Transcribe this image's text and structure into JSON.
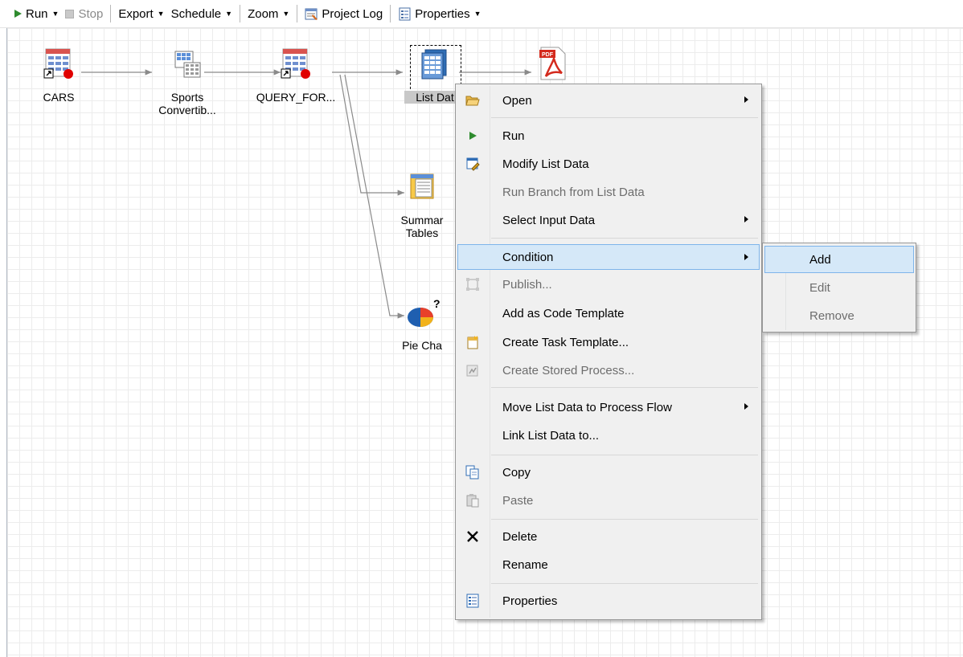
{
  "toolbar": {
    "run": "Run",
    "stop": "Stop",
    "export": "Export",
    "schedule": "Schedule",
    "zoom": "Zoom",
    "project_log": "Project Log",
    "properties": "Properties"
  },
  "flow": {
    "nodes": {
      "cars": "CARS",
      "sports_1": "Sports",
      "sports_2": "Convertib...",
      "query": "QUERY_FOR...",
      "list_data": "List Dat",
      "summary_1": "Summar",
      "summary_2": "Tables",
      "pie": "Pie Cha"
    },
    "pdf_badge": "PDF"
  },
  "context_menu": {
    "items": {
      "open": "Open",
      "run": "Run",
      "modify": "Modify List Data",
      "run_branch": "Run Branch from List Data",
      "select_input": "Select Input Data",
      "condition": "Condition",
      "publish": "Publish...",
      "add_code_template": "Add as Code Template",
      "create_task_template": "Create Task Template...",
      "create_stored_process": "Create Stored Process...",
      "move": "Move List Data to Process Flow",
      "link": "Link List Data to...",
      "copy": "Copy",
      "paste": "Paste",
      "delete": "Delete",
      "rename": "Rename",
      "properties": "Properties"
    }
  },
  "submenu": {
    "add": "Add",
    "edit": "Edit",
    "remove": "Remove"
  },
  "colors": {
    "highlight": "#d5e8f8",
    "highlight_border": "#7eb4ea",
    "menu_bg": "#f0f0f0",
    "run_green": "#2e8b2e",
    "pdf_red": "#d42b1e"
  }
}
